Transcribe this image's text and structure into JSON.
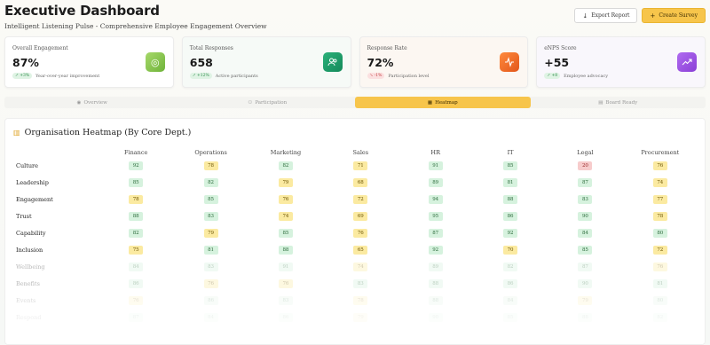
{
  "header": {
    "title": "Executive Dashboard",
    "subtitle": "Intelligent Listening Pulse - Comprehensive Employee Engagement Overview",
    "export_label": "Export Report",
    "create_label": "Create Survey"
  },
  "kpis": [
    {
      "label": "Overall Engagement",
      "value": "87%",
      "delta": "+3%",
      "delta_dir": "up",
      "note": "Year-over-year improvement",
      "icon": "target-icon",
      "icon_color": "#8bc34a"
    },
    {
      "label": "Total Responses",
      "value": "658",
      "delta": "+12%",
      "delta_dir": "up",
      "note": "Active participants",
      "icon": "users-icon",
      "icon_color": "#1f9d6b"
    },
    {
      "label": "Response Rate",
      "value": "72%",
      "delta": "-1%",
      "delta_dir": "down",
      "note": "Participation level",
      "icon": "activity-icon",
      "icon_color": "#f26a21"
    },
    {
      "label": "eNPS Score",
      "value": "+55",
      "delta": "+8",
      "delta_dir": "up",
      "note": "Employee advocacy",
      "icon": "trend-icon",
      "icon_color": "#9b4fe0"
    }
  ],
  "tabs": [
    {
      "label": "Overview",
      "icon": "eye-icon",
      "active": false
    },
    {
      "label": "Participation",
      "icon": "users-icon",
      "active": false
    },
    {
      "label": "Heatmap",
      "icon": "grid-icon",
      "active": true
    },
    {
      "label": "Board Ready",
      "icon": "document-icon",
      "active": false
    }
  ],
  "heatmap": {
    "title": "Organisation Heatmap (By Core Dept.)",
    "columns": [
      "Finance",
      "Operations",
      "Marketing",
      "Sales",
      "HR",
      "IT",
      "Legal",
      "Procurement"
    ],
    "rows": [
      {
        "label": "Culture",
        "values": [
          "92",
          "78",
          "82",
          "71",
          "91",
          "85",
          "20",
          "76"
        ]
      },
      {
        "label": "Leadership",
        "values": [
          "85",
          "82",
          "79",
          "68",
          "89",
          "81",
          "87",
          "74"
        ]
      },
      {
        "label": "Engagement",
        "values": [
          "78",
          "85",
          "76",
          "72",
          "94",
          "88",
          "83",
          "77"
        ]
      },
      {
        "label": "Trust",
        "values": [
          "88",
          "83",
          "74",
          "69",
          "95",
          "86",
          "90",
          "78"
        ]
      },
      {
        "label": "Capability",
        "values": [
          "82",
          "79",
          "85",
          "76",
          "87",
          "92",
          "84",
          "80"
        ]
      },
      {
        "label": "Inclusion",
        "values": [
          "75",
          "81",
          "88",
          "65",
          "92",
          "70",
          "85",
          "72"
        ]
      },
      {
        "label": "Wellbeing",
        "values": [
          "84",
          "83",
          "91",
          "74",
          "89",
          "82",
          "87",
          "76"
        ]
      },
      {
        "label": "Benefits",
        "values": [
          "86",
          "76",
          "76",
          "83",
          "88",
          "86",
          "90",
          "81"
        ]
      },
      {
        "label": "Events",
        "values": [
          "76",
          "86",
          "83",
          "78",
          "88",
          "84",
          "79",
          "80"
        ]
      },
      {
        "label": "Respond",
        "values": [
          "87",
          "84",
          "86",
          "79",
          "90",
          "85",
          "88",
          "82"
        ]
      }
    ]
  },
  "colors": {
    "accent": "#f7c54b",
    "good": "#d6f2de",
    "warn": "#fbeaa1",
    "bad": "#f7cccc"
  }
}
